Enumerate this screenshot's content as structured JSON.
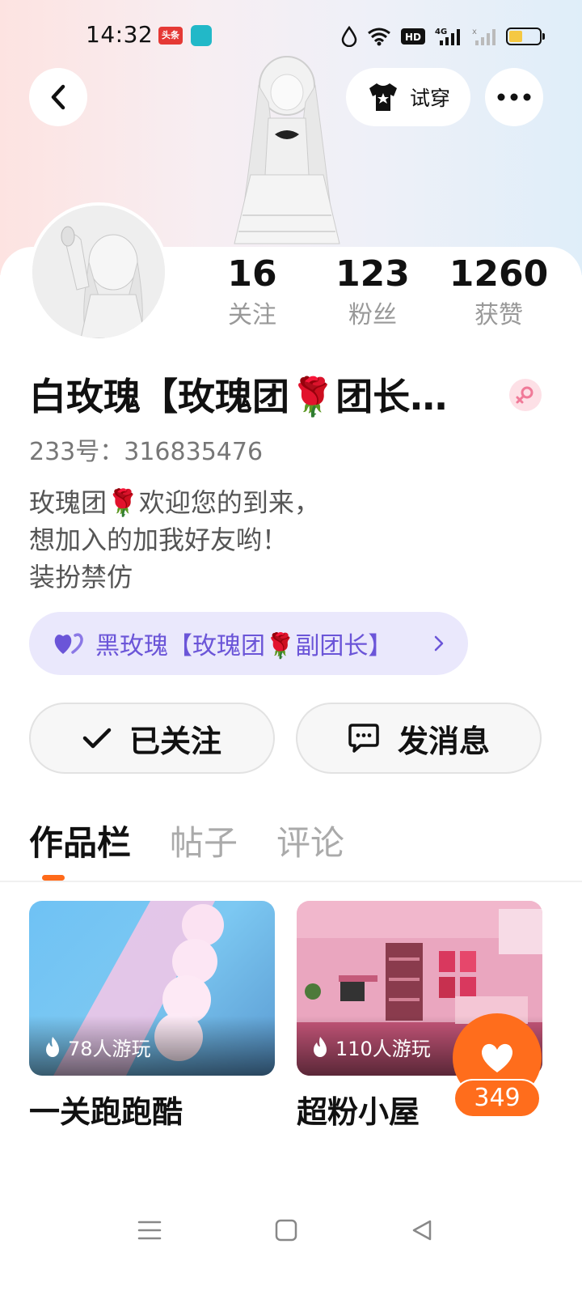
{
  "status_bar": {
    "time": "14:32",
    "news_badge": "头条",
    "battery_level": 0.45,
    "icons": [
      "droplet-icon",
      "wifi-icon",
      "hd-icon",
      "signal-4g-icon",
      "signal-empty-icon",
      "battery-icon"
    ]
  },
  "header": {
    "tryon_label": "试穿"
  },
  "profile": {
    "name": "白玫瑰【玫瑰团🌹团长…",
    "uid": "233号：316835476",
    "bio": [
      "玫瑰团🌹欢迎您的到来，",
      "想加入的加我好友哟！",
      "装扮禁仿"
    ]
  },
  "stats": [
    {
      "value": "16",
      "label": "关注"
    },
    {
      "value": "123",
      "label": "粉丝"
    },
    {
      "value": "1260",
      "label": "获赞"
    }
  ],
  "friend_chip": {
    "label": "黑玫瑰【玫瑰团🌹副团长】"
  },
  "actions": {
    "follow_label": "已关注",
    "message_label": "发消息"
  },
  "tabs": [
    {
      "label": "作品栏",
      "active": true
    },
    {
      "label": "帖子",
      "active": false
    },
    {
      "label": "评论",
      "active": false
    }
  ],
  "works": [
    {
      "title": "一关跑跑酷",
      "plays": "78人游玩"
    },
    {
      "title": "超粉小屋",
      "plays": "110人游玩"
    }
  ],
  "like": {
    "count": "349"
  },
  "colors": {
    "accent": "#ff6d1c",
    "chip_bg": "#eae8fc",
    "chip_text": "#6b55d8"
  }
}
